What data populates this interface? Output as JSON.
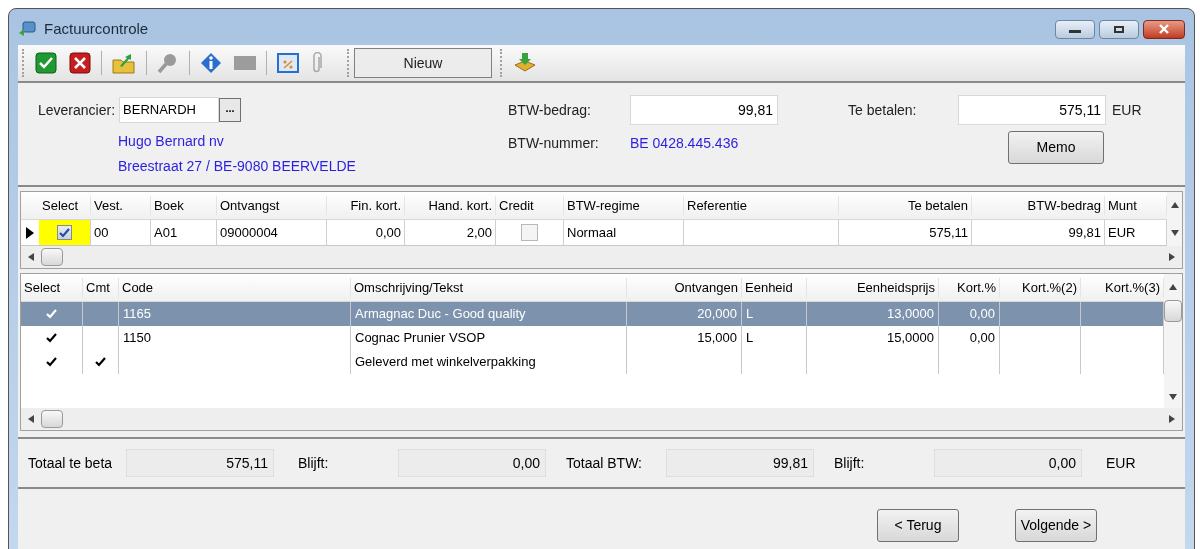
{
  "window": {
    "title": "Factuurcontrole"
  },
  "toolbar": {
    "new_button": "Nieuw"
  },
  "header": {
    "supplier_label": "Leverancier:",
    "supplier_value": "BERNARDH",
    "browse_button": "...",
    "supplier_name": "Hugo Bernard nv",
    "supplier_address": "Breestraat 27 / BE-9080 BEERVELDE",
    "vat_amount_label": "BTW-bedrag:",
    "vat_amount_value": "99,81",
    "vat_number_label": "BTW-nummer:",
    "vat_number_value": "BE 0428.445.436",
    "to_pay_label": "Te betalen:",
    "to_pay_value": "575,11",
    "currency": "EUR",
    "memo_button": "Memo"
  },
  "invoices": {
    "columns": [
      {
        "label": "Select"
      },
      {
        "label": "Vest."
      },
      {
        "label": "Boek"
      },
      {
        "label": "Ontvangst"
      },
      {
        "label": "Fin. kort."
      },
      {
        "label": "Hand. kort."
      },
      {
        "label": "Credit"
      },
      {
        "label": "BTW-regime"
      },
      {
        "label": "Referentie"
      },
      {
        "label": "Te betalen"
      },
      {
        "label": "BTW-bedrag"
      },
      {
        "label": "Munt"
      }
    ],
    "rows": [
      {
        "current": true,
        "select": true,
        "vest": "00",
        "boek": "A01",
        "ontvangst": "09000004",
        "fin_kort": "0,00",
        "hand_kort": "2,00",
        "credit": false,
        "btw_regime": "Normaal",
        "te_betalen": "575,11",
        "btw_bedrag": "99,81",
        "munt": "EUR"
      }
    ]
  },
  "lines": {
    "columns": [
      {
        "label": "Select"
      },
      {
        "label": "Cmt"
      },
      {
        "label": "Code"
      },
      {
        "label": "Omschrijving/Tekst"
      },
      {
        "label": "Ontvangen"
      },
      {
        "label": "Eenheid"
      },
      {
        "label": "Eenheidsprijs"
      },
      {
        "label": "Kort.%"
      },
      {
        "label": "Kort.%(2)"
      },
      {
        "label": "Kort.%(3)"
      }
    ],
    "rows": [
      {
        "selected": true,
        "select": true,
        "cmt": false,
        "code": "1165",
        "text": "Armagnac Duc - Good quality",
        "received": "20,000",
        "unit": "L",
        "unit_price": "13,0000",
        "discount": "0,00"
      },
      {
        "selected": false,
        "select": true,
        "cmt": false,
        "code": "1150",
        "text": "Cognac Prunier VSOP",
        "received": "15,000",
        "unit": "L",
        "unit_price": "15,0000",
        "discount": "0,00"
      },
      {
        "selected": false,
        "select": true,
        "cmt": true,
        "text": "Geleverd met winkelverpakking"
      }
    ]
  },
  "totals": [
    {
      "label": "Totaal te beta",
      "value": "575,11"
    },
    {
      "label": "Blijft:",
      "value": "0,00"
    },
    {
      "label": "Totaal BTW:",
      "value": "99,81"
    },
    {
      "label": "Blijft:",
      "value": "0,00"
    }
  ],
  "totals_currency": "EUR",
  "buttons": [
    {
      "label": "< Terug"
    },
    {
      "label": "Volgende >"
    }
  ]
}
